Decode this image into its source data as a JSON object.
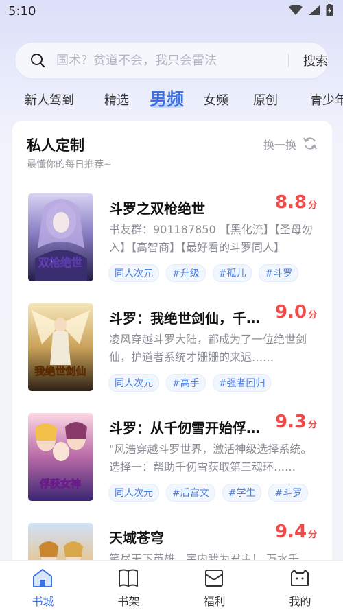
{
  "status_bar": {
    "time": "5:10"
  },
  "search": {
    "placeholder": "国术？贫道不会，我只会雷法",
    "button_label": "搜索"
  },
  "tabs": [
    {
      "label": "新人驾到",
      "active": false
    },
    {
      "label": "精选",
      "active": false
    },
    {
      "label": "男频",
      "active": true
    },
    {
      "label": "女频",
      "active": false
    },
    {
      "label": "原创",
      "active": false
    },
    {
      "label": "青少年",
      "active": false
    }
  ],
  "section": {
    "title": "私人定制",
    "subtitle": "最懂你的每日推荐~",
    "refresh_label": "换一换"
  },
  "books": [
    {
      "title": "斗罗之双枪绝世",
      "score": "8.8",
      "score_unit": "分",
      "desc": "书友群：901187850 【黑化流】【圣母勿入】【高智商】【最好看的斗罗同人】",
      "tags": [
        "同人次元",
        "#升级",
        "#孤儿",
        "#斗罗"
      ],
      "cover_text": "双枪绝世",
      "cover_colors": [
        "#b7b2e6",
        "#5c4f9a",
        "#2b2450"
      ]
    },
    {
      "title": "斗罗：我绝世剑仙，千仞雪护道者",
      "score": "9.0",
      "score_unit": "分",
      "desc": "凌风穿越斗罗大陆，都成为了一位绝世剑仙，护道者系统才姗姗的来迟……",
      "tags": [
        "同人次元",
        "#高手",
        "#强者回归"
      ],
      "cover_text": "我绝世剑仙",
      "cover_colors": [
        "#f2d9a0",
        "#c99a4a",
        "#3a2a1a"
      ]
    },
    {
      "title": "斗罗：从千仞雪开始俘获女神",
      "score": "9.3",
      "score_unit": "分",
      "desc": "\"风浩穿越斗罗世界，激活神级选择系统。 选择一：帮助千仞雪获取第三魂环……",
      "tags": [
        "同人次元",
        "#后宫文",
        "#学生",
        "#斗罗"
      ],
      "cover_text": "俘获女神",
      "cover_colors": [
        "#f7c7d8",
        "#b05a9a",
        "#3a2470"
      ]
    },
    {
      "title": "天域苍穹",
      "score": "9.4",
      "score_unit": "分",
      "desc": "笑尽天下英雄，宇内我为君主！ 万水千山，以我为尊……",
      "tags": [],
      "cover_text": "",
      "cover_colors": [
        "#cfe0f7",
        "#e9c48c",
        "#7a4a30"
      ]
    }
  ],
  "bottom_nav": [
    {
      "label": "书城",
      "icon": "bookstore-icon",
      "active": true
    },
    {
      "label": "书架",
      "icon": "bookshelf-icon",
      "active": false
    },
    {
      "label": "福利",
      "icon": "gift-icon",
      "active": false
    },
    {
      "label": "我的",
      "icon": "profile-icon",
      "active": false
    }
  ],
  "colors": {
    "accent": "#3b6fe6",
    "score": "#f04b4b"
  }
}
